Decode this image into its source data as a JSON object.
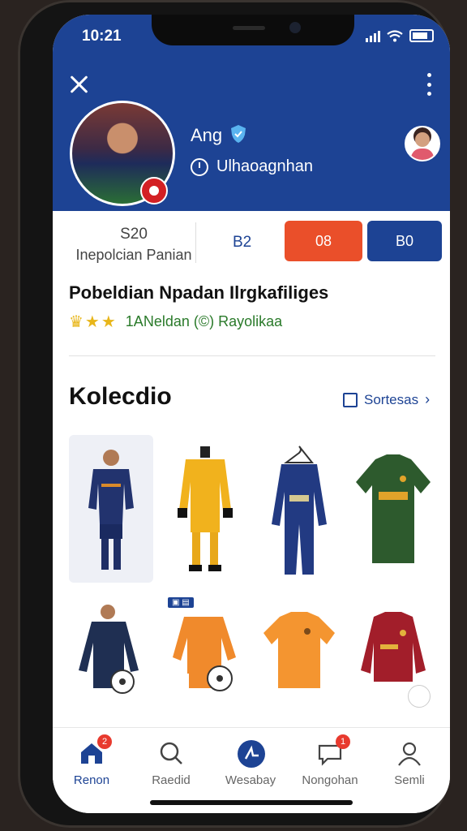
{
  "status_bar": {
    "time": "10:21"
  },
  "profile": {
    "name": "Ang",
    "subtitle": "Ulhaoagnhan"
  },
  "stats": {
    "main_value": "S20",
    "main_label": "Inepolcian Panian",
    "value_b2": "B2",
    "button_orange": "08",
    "button_blue": "B0"
  },
  "headline": "Pobeldian Npadan Ilrgkafiliges",
  "rating": {
    "stars": 3,
    "text": "1ANeldan (©) Rayolikaa"
  },
  "collection": {
    "title": "Kolecdio",
    "sort_label": "Sortesas",
    "items": [
      {
        "name": "Navy kit player",
        "color": "#22336e"
      },
      {
        "name": "Yellow goalkeeper kit",
        "color": "#f1b21d"
      },
      {
        "name": "Navy tracksuit on hanger",
        "color": "#223a82"
      },
      {
        "name": "Green jersey",
        "color": "#2d5a2d"
      },
      {
        "name": "Navy training shirt with ball",
        "color": "#1f2f52"
      },
      {
        "name": "Orange kit with ball",
        "color": "#f08a2c",
        "badge": "▣ ▤"
      },
      {
        "name": "Orange jersey",
        "color": "#f49530"
      },
      {
        "name": "Red long-sleeve jersey",
        "color": "#a21e2a"
      }
    ]
  },
  "bottom_nav": [
    {
      "label": "Renon",
      "badge": "2",
      "icon": "home-icon",
      "active": true
    },
    {
      "label": "Raedid",
      "icon": "search-icon"
    },
    {
      "label": "Wesabay",
      "icon": "compass-icon"
    },
    {
      "label": "Nongohan",
      "badge": "1",
      "icon": "chat-icon"
    },
    {
      "label": "Semli",
      "icon": "person-icon"
    }
  ],
  "colors": {
    "brand_blue": "#1d4394",
    "accent_orange": "#ea4f2a"
  }
}
